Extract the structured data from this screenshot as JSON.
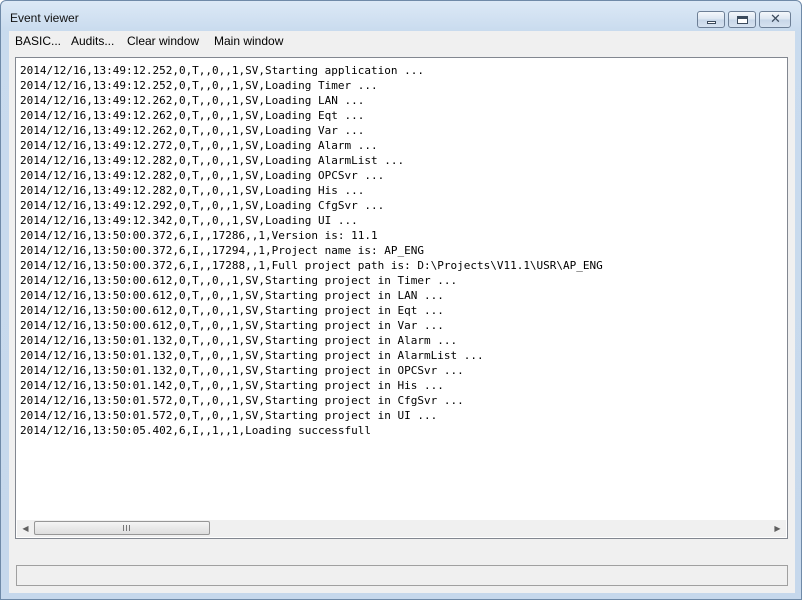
{
  "window": {
    "title": "Event viewer",
    "controls": {
      "minimize": "minimize",
      "maximize": "maximize",
      "close": "✕"
    }
  },
  "menu": {
    "items": [
      {
        "label": "BASIC..."
      },
      {
        "label": "Audits..."
      },
      {
        "label": "Clear window"
      },
      {
        "label": "Main window"
      }
    ]
  },
  "log": {
    "lines": [
      "2014/12/16,13:49:12.252,0,T,,0,,1,SV,Starting application ...",
      "2014/12/16,13:49:12.252,0,T,,0,,1,SV,Loading Timer ...",
      "2014/12/16,13:49:12.262,0,T,,0,,1,SV,Loading LAN ...",
      "2014/12/16,13:49:12.262,0,T,,0,,1,SV,Loading Eqt ...",
      "2014/12/16,13:49:12.262,0,T,,0,,1,SV,Loading Var ...",
      "2014/12/16,13:49:12.272,0,T,,0,,1,SV,Loading Alarm ...",
      "2014/12/16,13:49:12.282,0,T,,0,,1,SV,Loading AlarmList ...",
      "2014/12/16,13:49:12.282,0,T,,0,,1,SV,Loading OPCSvr ...",
      "2014/12/16,13:49:12.282,0,T,,0,,1,SV,Loading His ...",
      "2014/12/16,13:49:12.292,0,T,,0,,1,SV,Loading CfgSvr ...",
      "2014/12/16,13:49:12.342,0,T,,0,,1,SV,Loading UI ...",
      "2014/12/16,13:50:00.372,6,I,,17286,,1,Version is: 11.1",
      "2014/12/16,13:50:00.372,6,I,,17294,,1,Project name is: AP_ENG",
      "2014/12/16,13:50:00.372,6,I,,17288,,1,Full project path is: D:\\Projects\\V11.1\\USR\\AP_ENG",
      "2014/12/16,13:50:00.612,0,T,,0,,1,SV,Starting project in Timer ...",
      "2014/12/16,13:50:00.612,0,T,,0,,1,SV,Starting project in LAN ...",
      "2014/12/16,13:50:00.612,0,T,,0,,1,SV,Starting project in Eqt ...",
      "2014/12/16,13:50:00.612,0,T,,0,,1,SV,Starting project in Var ...",
      "2014/12/16,13:50:01.132,0,T,,0,,1,SV,Starting project in Alarm ...",
      "2014/12/16,13:50:01.132,0,T,,0,,1,SV,Starting project in AlarmList ...",
      "2014/12/16,13:50:01.132,0,T,,0,,1,SV,Starting project in OPCSvr ...",
      "2014/12/16,13:50:01.142,0,T,,0,,1,SV,Starting project in His ...",
      "2014/12/16,13:50:01.572,0,T,,0,,1,SV,Starting project in CfgSvr ...",
      "2014/12/16,13:50:01.572,0,T,,0,,1,SV,Starting project in UI ...",
      "2014/12/16,13:50:05.402,6,I,,1,,1,Loading successfull"
    ]
  },
  "scrollbar": {
    "left_arrow": "◀",
    "right_arrow": "▶",
    "thumb_fraction": 0.24
  },
  "status": {
    "text": ""
  }
}
